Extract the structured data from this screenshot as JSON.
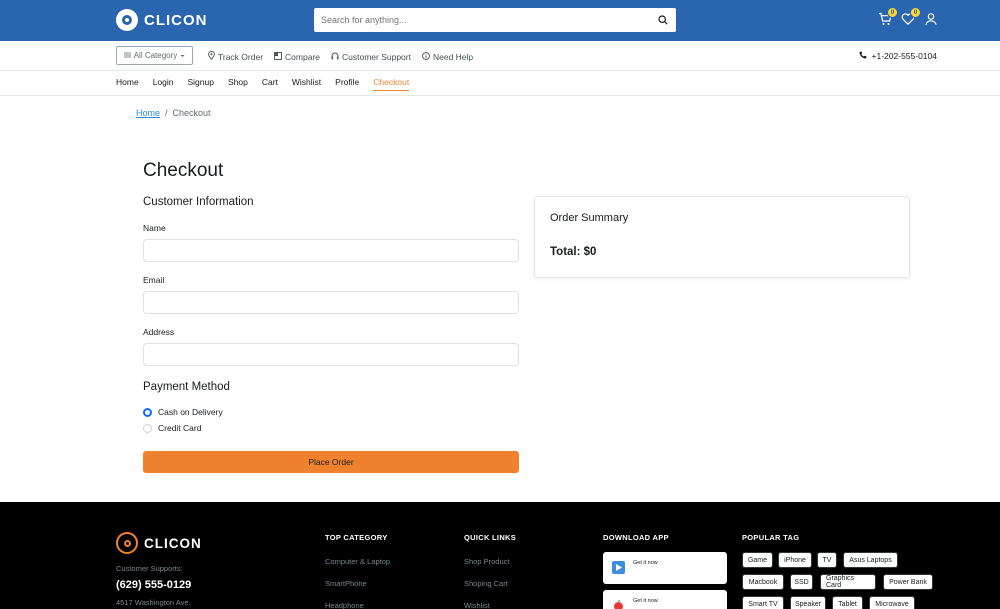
{
  "brand": {
    "name": "CLICON"
  },
  "search": {
    "placeholder": "Search for anything..."
  },
  "header": {
    "cart_count": "0",
    "wishlist_count": "0"
  },
  "subbar": {
    "category_label": "All Category",
    "links": [
      "Track Order",
      "Compare",
      "Customer Support",
      "Need Help"
    ],
    "phone": "+1-202-555-0104"
  },
  "nav": {
    "items": [
      "Home",
      "Login",
      "Signup",
      "Shop",
      "Cart",
      "Wishlist",
      "Profile",
      "Checkout"
    ],
    "active": "Checkout"
  },
  "breadcrumb": {
    "home": "Home",
    "separator": "/",
    "current": "Checkout"
  },
  "checkout": {
    "title": "Checkout",
    "customer_info_title": "Customer Information",
    "name_label": "Name",
    "email_label": "Email",
    "address_label": "Address",
    "payment_title": "Payment Method",
    "payment_options": [
      {
        "label": "Cash on Delivery",
        "selected": true
      },
      {
        "label": "Credit Card",
        "selected": false
      }
    ],
    "place_order_label": "Place Order"
  },
  "summary": {
    "title": "Order Summary",
    "total": "Total: $0"
  },
  "footer": {
    "support_label": "Customer Supports:",
    "phone": "(629) 555-0129",
    "address": "4517 Washington Ave.",
    "top_category_title": "TOP CATEGORY",
    "top_category": [
      "Computer & Laptop",
      "SmartPhone",
      "Headphone"
    ],
    "quick_links_title": "QUICK LINKS",
    "quick_links": [
      "Shop Product",
      "Shoping Cart",
      "Wishlist"
    ],
    "download_title": "DOWNLOAD APP",
    "app_buttons": [
      "Get it now",
      "Get it now"
    ],
    "popular_tag_title": "POPULAR TAG",
    "tags": [
      "Game",
      "iPhone",
      "TV",
      "Asus Laptops",
      "Macbook",
      "SSD",
      "Graphics Card",
      "Power Bank",
      "Smart TV",
      "Speaker",
      "Tablet",
      "Microwave"
    ]
  },
  "colors": {
    "topbar": "#2a66b0",
    "accent": "#f0822f",
    "link": "#2d8cd9",
    "radio": "#0d6efd"
  }
}
